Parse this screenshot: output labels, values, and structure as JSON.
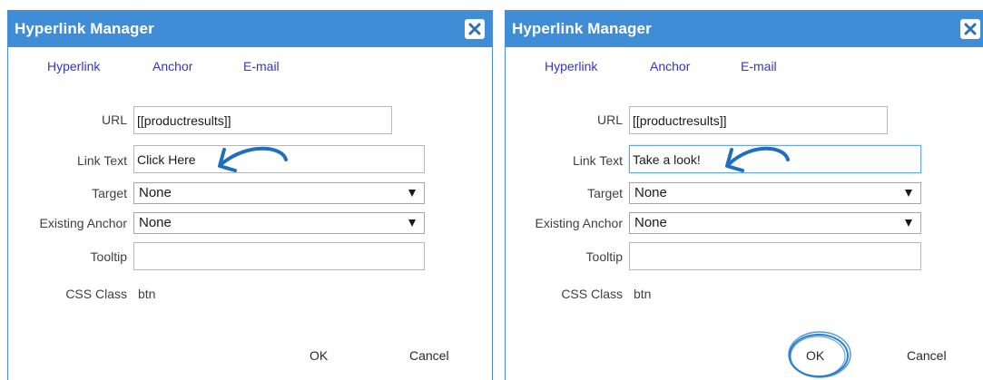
{
  "dialogs": [
    {
      "title": "Hyperlink Manager",
      "tabs": [
        "Hyperlink",
        "Anchor",
        "E-mail"
      ],
      "fields": {
        "url_label": "URL",
        "url_value": "[[productresults]]",
        "link_text_label": "Link Text",
        "link_text_value": "Click Here",
        "target_label": "Target",
        "target_value": "None",
        "anchor_label": "Existing Anchor",
        "anchor_value": "None",
        "tooltip_label": "Tooltip",
        "tooltip_value": "",
        "css_label": "CSS Class",
        "css_value": "btn"
      },
      "buttons": {
        "ok": "OK",
        "cancel": "Cancel"
      }
    },
    {
      "title": "Hyperlink Manager",
      "tabs": [
        "Hyperlink",
        "Anchor",
        "E-mail"
      ],
      "fields": {
        "url_label": "URL",
        "url_value": "[[productresults]]",
        "link_text_label": "Link Text",
        "link_text_value": "Take a look!",
        "target_label": "Target",
        "target_value": "None",
        "anchor_label": "Existing Anchor",
        "anchor_value": "None",
        "tooltip_label": "Tooltip",
        "tooltip_value": "",
        "css_label": "CSS Class",
        "css_value": "btn"
      },
      "buttons": {
        "ok": "OK",
        "cancel": "Cancel"
      }
    }
  ],
  "colors": {
    "titlebar": "#3f8dd6",
    "tab_link": "#3434cc",
    "annotation": "#1f6fc0"
  },
  "icons": {
    "close": "close-icon",
    "dropdown": "chevron-down-icon",
    "annotation_arrow": "curved-arrow-annotation",
    "annotation_circle": "circle-annotation"
  }
}
